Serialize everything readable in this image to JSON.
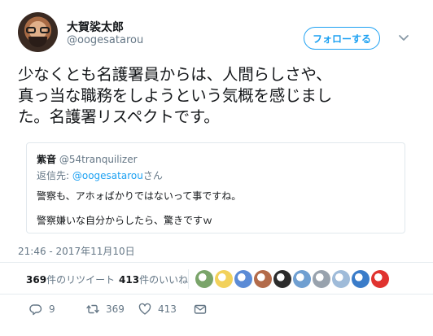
{
  "header": {
    "display_name": "大賀裟太郎",
    "screen_name": "@oogesatarou",
    "follow_label": "フォローする"
  },
  "tweet": {
    "text_lines": [
      "少なくとも名護署員からは、人間らしさや、",
      "真っ当な職務をしようという気概を感じまし",
      "た。名護署リスペクトです。"
    ]
  },
  "quote": {
    "author_name": "紫音",
    "author_handle": "@54tranquilizer",
    "reply_prefix": "返信先: ",
    "reply_to": "@oogesatarou",
    "reply_suffix": "さん",
    "line1": "警察も、アホォばかりではないって事ですね。",
    "line2": "警察嫌いな自分からしたら、驚きですｗ"
  },
  "timestamp": "21:46 - 2017年11月10日",
  "stats": {
    "retweets_count": "369",
    "retweets_label": "件のリツイート",
    "likes_count": "413",
    "likes_label": "件のいいね"
  },
  "likers": [
    {
      "color": "#7aa46a",
      "icon": "field-avatar"
    },
    {
      "color": "#f2d15b",
      "icon": "cartoon-avatar"
    },
    {
      "color": "#5b8bd6",
      "icon": "anime-avatar"
    },
    {
      "color": "#b36b4a",
      "icon": "person-avatar"
    },
    {
      "color": "#2c2c2c",
      "icon": "dark-avatar"
    },
    {
      "color": "#6f9fd1",
      "icon": "blue-avatar"
    },
    {
      "color": "#98a2ad",
      "icon": "gray-avatar"
    },
    {
      "color": "#9fbbd9",
      "icon": "sky-avatar"
    },
    {
      "color": "#3a7cc9",
      "icon": "fireworks-avatar"
    },
    {
      "color": "#e0332f",
      "icon": "daruma-avatar"
    }
  ],
  "actions": {
    "reply_count": "9",
    "retweet_count": "369",
    "like_count": "413"
  },
  "colors": {
    "accent": "#1da1f2",
    "secondary_text": "#657786",
    "border": "#e1e8ed"
  }
}
